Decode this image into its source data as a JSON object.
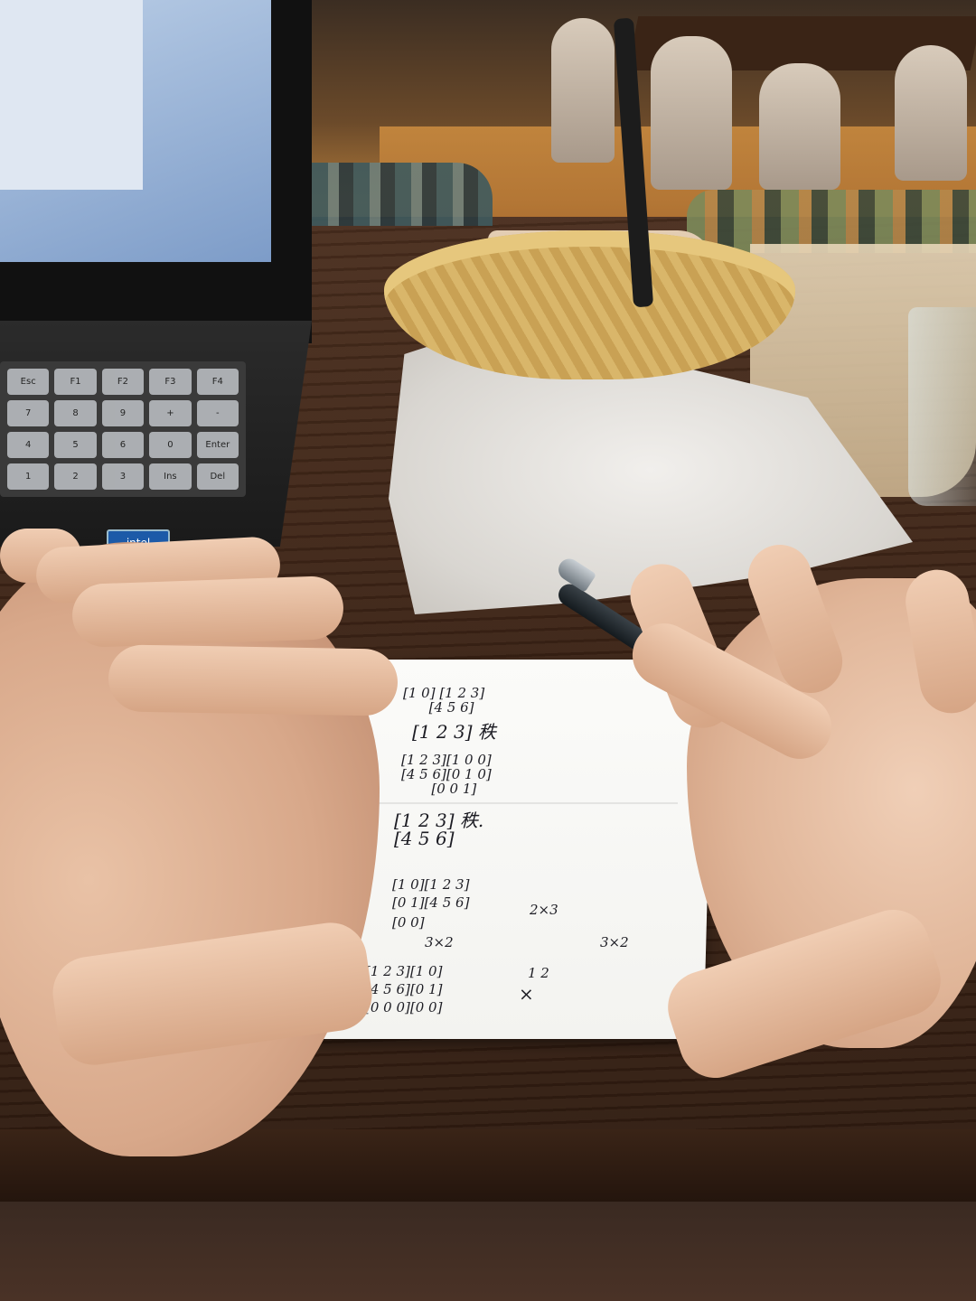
{
  "scene": {
    "setting": "cafe",
    "laptop": {
      "keys": [
        "Esc",
        "F1",
        "F2",
        "F3",
        "F4",
        "7",
        "8",
        "9",
        "+",
        "-",
        "4",
        "5",
        "6",
        "0",
        "Enter",
        "1",
        "2",
        "3",
        "Ins",
        "Del"
      ],
      "sticker_text": "intel"
    },
    "note_lines": [
      "[1 0] [1 2 3]",
      "      [4 5 6]",
      "[1 2 3] 秩",
      "[1 2 3][1 0 0]",
      "[4 5 6][0 1 0]",
      "       [0 0 1]",
      "[1 2 3] 秩.",
      "[4 5 6]",
      "[1 0][1 2 3]",
      "[0 1][4 5 6]",
      "[0 0]",
      "3×2",
      "2×3",
      "3×2",
      "[1 2 3][1 0]",
      "[4 5 6][0 1]",
      "[0 0 0][0 0]",
      "1 2",
      "×"
    ]
  }
}
